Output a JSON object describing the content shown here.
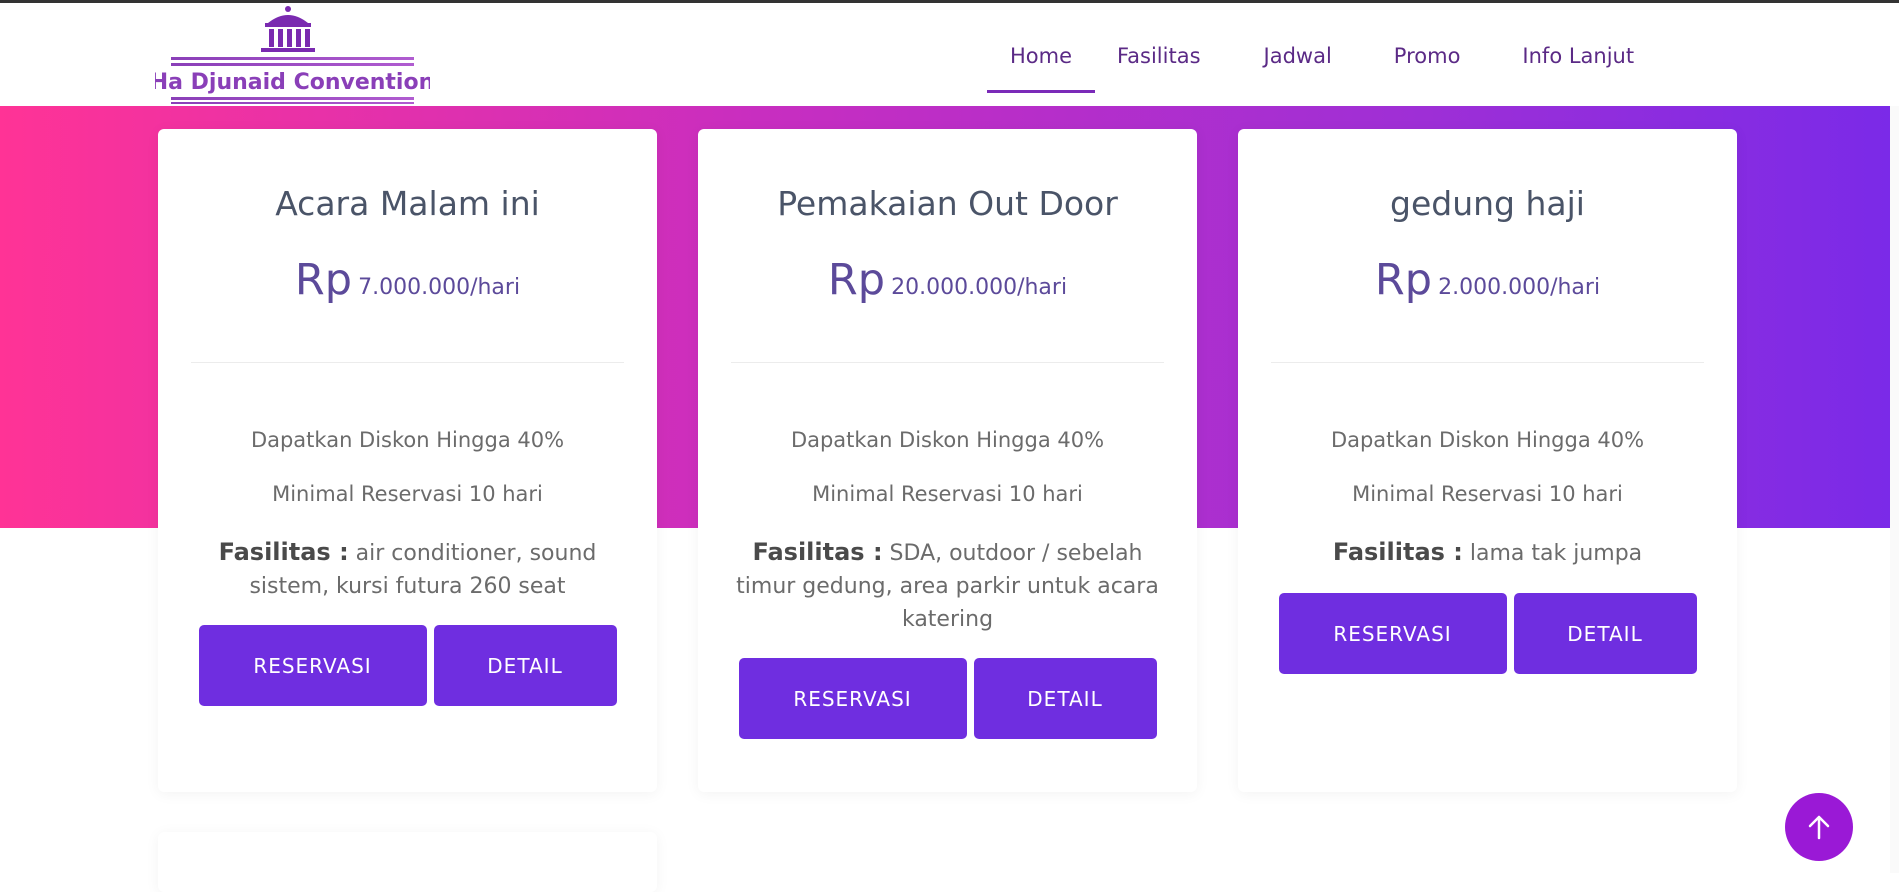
{
  "brand": {
    "logo_text": "Ha Djunaid Convention"
  },
  "nav": {
    "items": [
      {
        "label": "Home",
        "active": true
      },
      {
        "label": "Fasilitas"
      },
      {
        "label": "Jadwal"
      },
      {
        "label": "Promo"
      },
      {
        "label": "Info Lanjut"
      }
    ]
  },
  "packages": [
    {
      "title": "Acara Malam ini",
      "currency": "Rp",
      "price": "7.000.000/hari",
      "discount": "Dapatkan Diskon Hingga 40%",
      "min_reservation": "Minimal Reservasi 10 hari",
      "facilities_label": "Fasilitas :",
      "facilities": "air conditioner, sound sistem, kursi futura 260 seat",
      "reserve_label": "RESERVASI",
      "detail_label": "DETAIL"
    },
    {
      "title": "Pemakaian Out Door",
      "currency": "Rp",
      "price": "20.000.000/hari",
      "discount": "Dapatkan Diskon Hingga 40%",
      "min_reservation": "Minimal Reservasi 10 hari",
      "facilities_label": "Fasilitas :",
      "facilities": "SDA, outdoor / sebelah timur gedung, area parkir untuk acara katering",
      "reserve_label": "RESERVASI",
      "detail_label": "DETAIL"
    },
    {
      "title": "gedung haji",
      "currency": "Rp",
      "price": "2.000.000/hari",
      "discount": "Dapatkan Diskon Hingga 40%",
      "min_reservation": "Minimal Reservasi 10 hari",
      "facilities_label": "Fasilitas :",
      "facilities": "lama tak jumpa",
      "reserve_label": "RESERVASI",
      "detail_label": "DETAIL"
    }
  ],
  "colors": {
    "accent": "#6f2ee0",
    "nav_text": "#5b2a86",
    "hero_start": "#ff3396",
    "hero_end": "#7a2ae8",
    "back_to_top": "#9a19d6"
  },
  "back_to_top": {
    "icon": "arrow-up-icon"
  }
}
